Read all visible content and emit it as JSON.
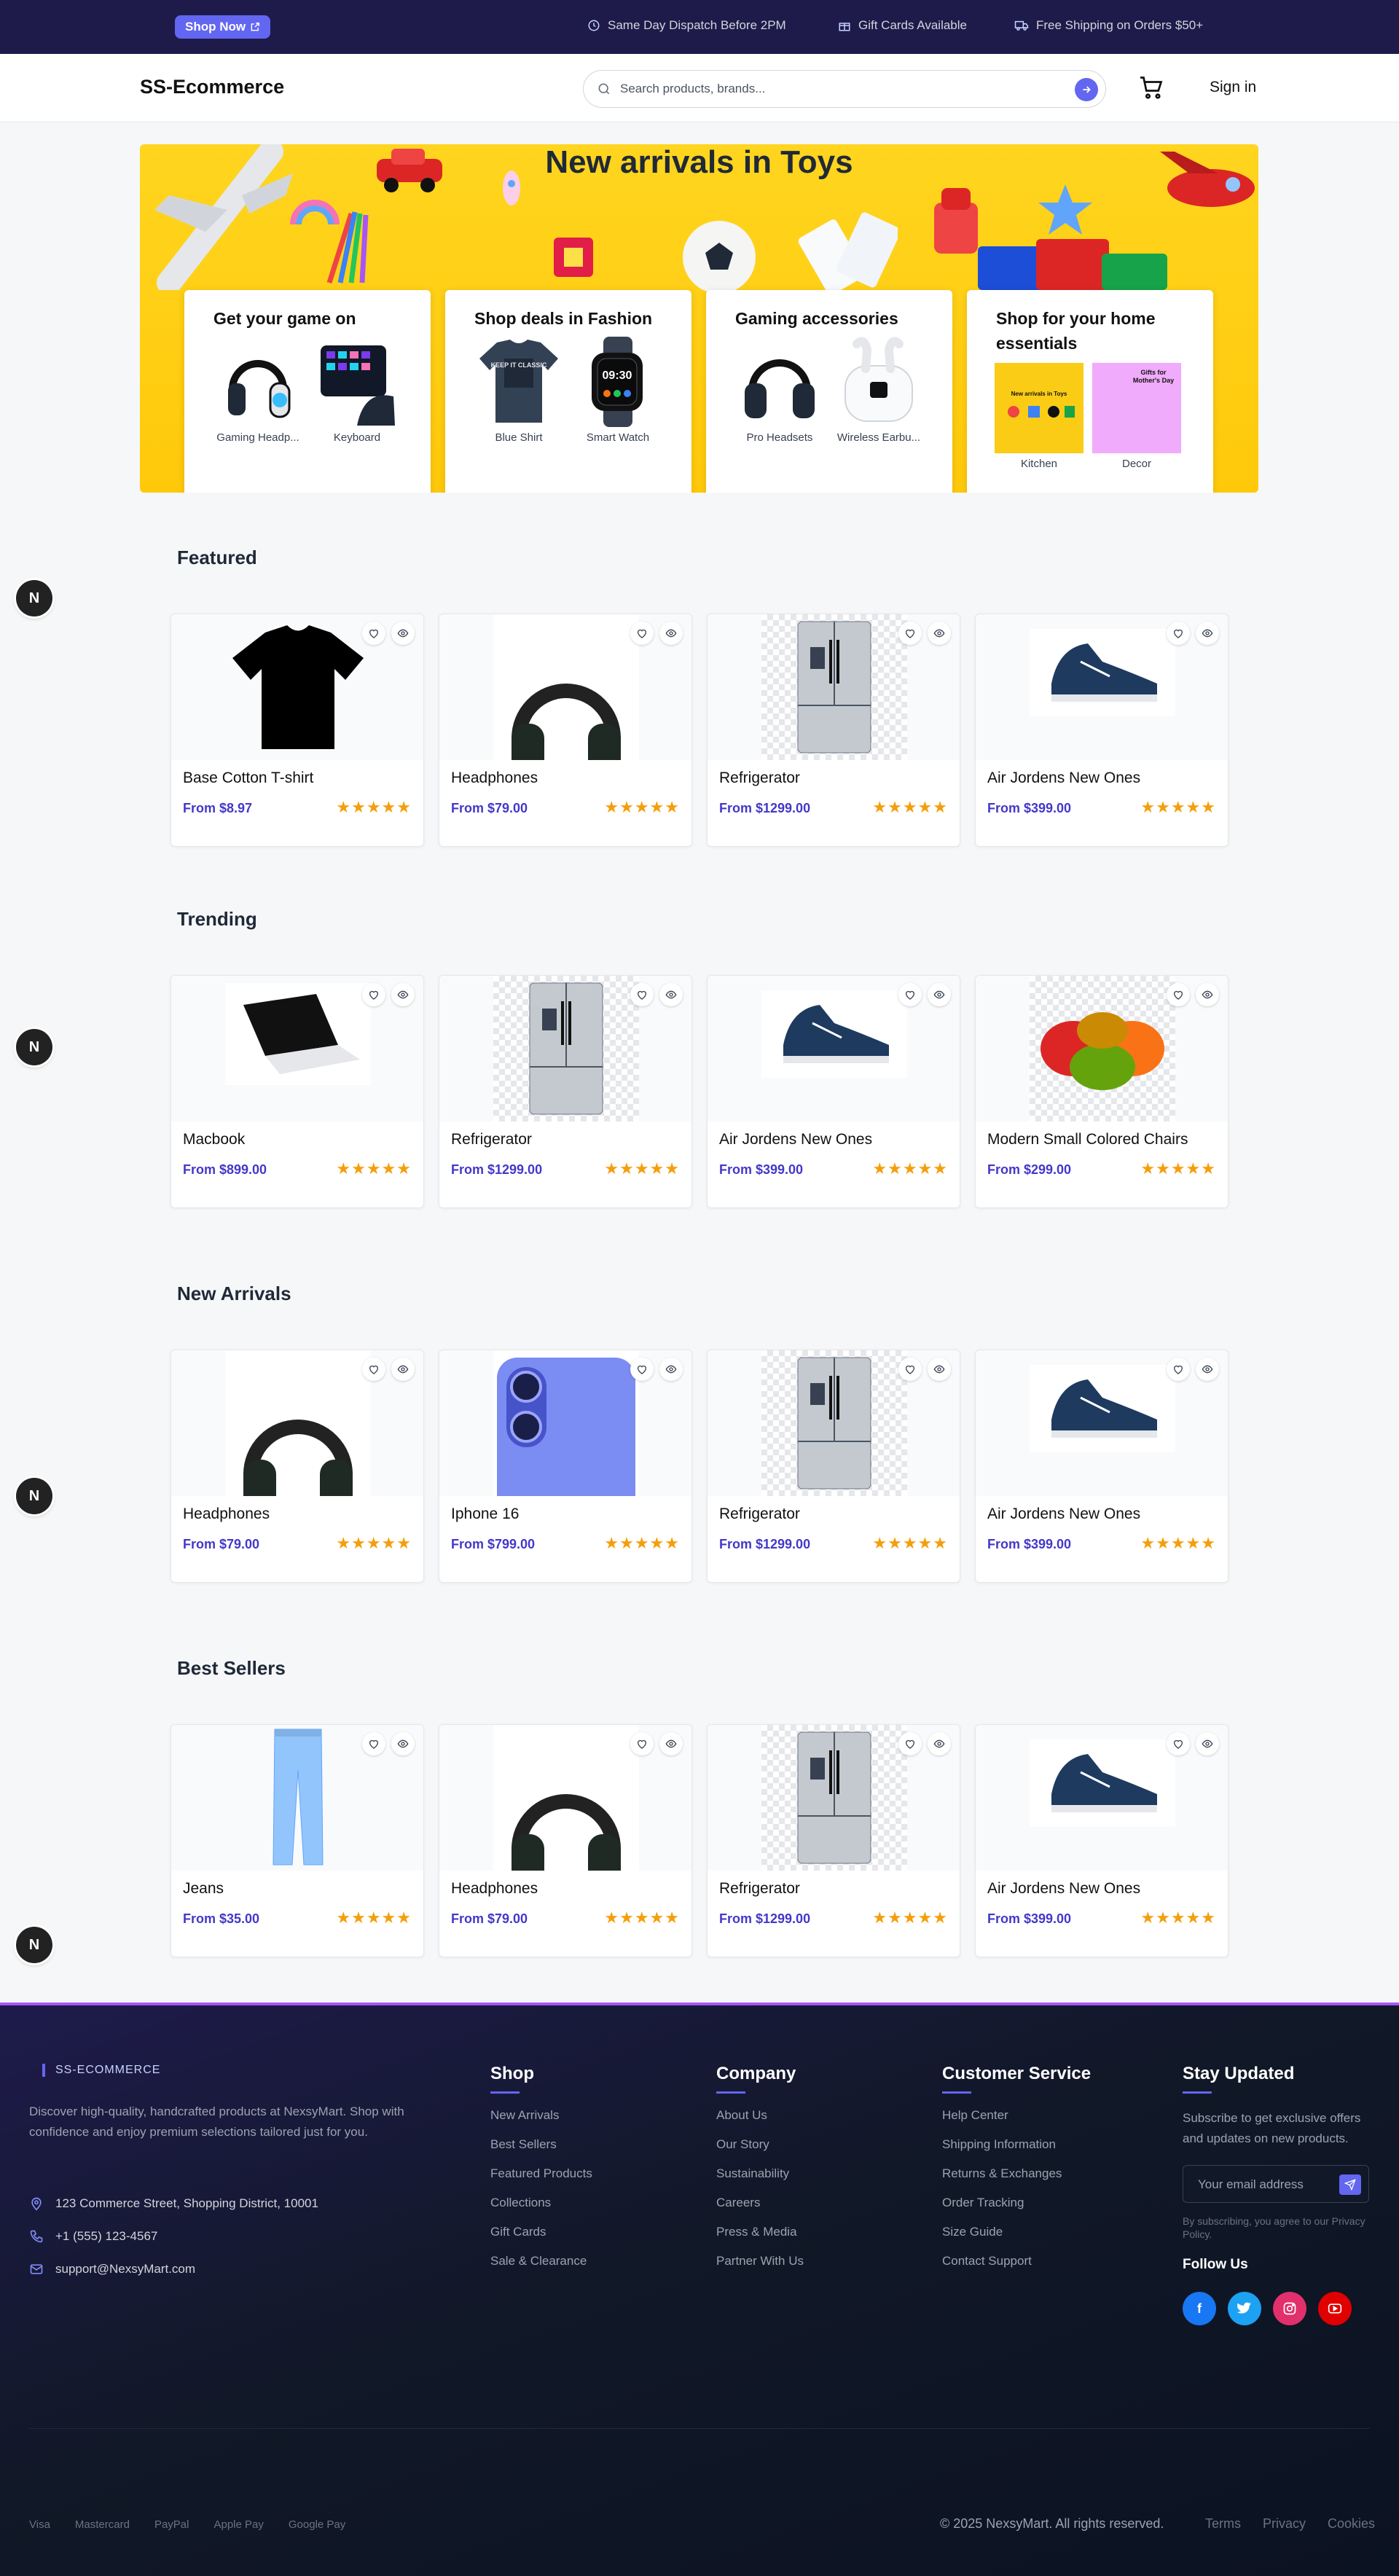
{
  "topbar": {
    "shop_now": "Shop Now",
    "info": [
      {
        "icon": "clock-icon",
        "text": "Same Day Dispatch Before 2PM"
      },
      {
        "icon": "gift-icon",
        "text": "Gift Cards Available"
      },
      {
        "icon": "truck-icon",
        "text": "Free Shipping on Orders $50+"
      }
    ]
  },
  "header": {
    "brand": "SS-Ecommerce",
    "search_placeholder": "Search products, brands...",
    "sign_in": "Sign in"
  },
  "hero": {
    "title": "New arrivals in Toys",
    "cards": [
      {
        "title": "Get your game on",
        "tiles": [
          "Gaming Headp...",
          "Keyboard"
        ]
      },
      {
        "title": "Shop deals in Fashion",
        "tiles": [
          "Blue Shirt",
          "Smart Watch"
        ]
      },
      {
        "title": "Gaming accessories",
        "tiles": [
          "Pro Headsets",
          "Wireless Earbu..."
        ]
      },
      {
        "title": "Shop for your home essentials",
        "tiles": [
          "Kitchen",
          "Decor"
        ]
      }
    ],
    "mini_labels": {
      "kitchen": "New arrivals in Toys",
      "decor": "Gifts for Mother's Day"
    },
    "shirt_text": "KEEP IT CLASSIC",
    "watch_time": "09:30"
  },
  "sections": [
    {
      "title": "Featured",
      "products": [
        {
          "name": "Base Cotton T-shirt",
          "price": "From $8.97",
          "image": "tshirt",
          "rating": 5
        },
        {
          "name": "Headphones",
          "price": "From $79.00",
          "image": "headphones",
          "rating": 5
        },
        {
          "name": "Refrigerator",
          "price": "From $1299.00",
          "image": "fridge",
          "rating": 5
        },
        {
          "name": "Air Jordens New Ones",
          "price": "From $399.00",
          "image": "sneaker",
          "rating": 5
        }
      ]
    },
    {
      "title": "Trending",
      "products": [
        {
          "name": "Macbook",
          "price": "From $899.00",
          "image": "laptop",
          "rating": 5
        },
        {
          "name": "Refrigerator",
          "price": "From $1299.00",
          "image": "fridge",
          "rating": 5
        },
        {
          "name": "Air Jordens New Ones",
          "price": "From $399.00",
          "image": "sneaker",
          "rating": 5
        },
        {
          "name": "Modern Small Colored Chairs",
          "price": "From $299.00",
          "image": "chairs",
          "rating": 5
        }
      ]
    },
    {
      "title": "New Arrivals",
      "products": [
        {
          "name": "Headphones",
          "price": "From $79.00",
          "image": "headphones",
          "rating": 5
        },
        {
          "name": "Iphone 16",
          "price": "From $799.00",
          "image": "phone",
          "rating": 5
        },
        {
          "name": "Refrigerator",
          "price": "From $1299.00",
          "image": "fridge",
          "rating": 5
        },
        {
          "name": "Air Jordens New Ones",
          "price": "From $399.00",
          "image": "sneaker",
          "rating": 5
        }
      ]
    },
    {
      "title": "Best Sellers",
      "products": [
        {
          "name": "Jeans",
          "price": "From $35.00",
          "image": "jeans",
          "rating": 5
        },
        {
          "name": "Headphones",
          "price": "From $79.00",
          "image": "headphones",
          "rating": 5
        },
        {
          "name": "Refrigerator",
          "price": "From $1299.00",
          "image": "fridge",
          "rating": 5
        },
        {
          "name": "Air Jordens New Ones",
          "price": "From $399.00",
          "image": "sneaker",
          "rating": 5
        }
      ]
    }
  ],
  "badge_letter": "N",
  "footer": {
    "brand": "SS-ECOMMERCE",
    "description": "Discover high-quality, handcrafted products at NexsyMart. Shop with confidence and enjoy premium selections tailored just for you.",
    "contact": {
      "address": "123 Commerce Street, Shopping District, 10001",
      "phone": "+1 (555) 123-4567",
      "email": "support@NexsyMart.com"
    },
    "shop": {
      "title": "Shop",
      "links": [
        "New Arrivals",
        "Best Sellers",
        "Featured Products",
        "Collections",
        "Gift Cards",
        "Sale & Clearance"
      ]
    },
    "company": {
      "title": "Company",
      "links": [
        "About Us",
        "Our Story",
        "Sustainability",
        "Careers",
        "Press & Media",
        "Partner With Us"
      ]
    },
    "service": {
      "title": "Customer Service",
      "links": [
        "Help Center",
        "Shipping Information",
        "Returns & Exchanges",
        "Order Tracking",
        "Size Guide",
        "Contact Support"
      ]
    },
    "newsletter": {
      "title": "Stay Updated",
      "description": "Subscribe to get exclusive offers and updates on new products.",
      "placeholder": "Your email address",
      "fineprint": "By subscribing, you agree to our Privacy Policy.",
      "follow": "Follow Us"
    },
    "social_colors": {
      "facebook": "#1877f2",
      "twitter": "#1da1f2",
      "instagram": "#e1306c",
      "youtube": "#e00000"
    },
    "payments": [
      "Visa",
      "Mastercard",
      "PayPal",
      "Apple Pay",
      "Google Pay"
    ],
    "copyright": "© 2025 NexsyMart. All rights reserved.",
    "legal": [
      "Terms",
      "Privacy",
      "Cookies"
    ]
  }
}
